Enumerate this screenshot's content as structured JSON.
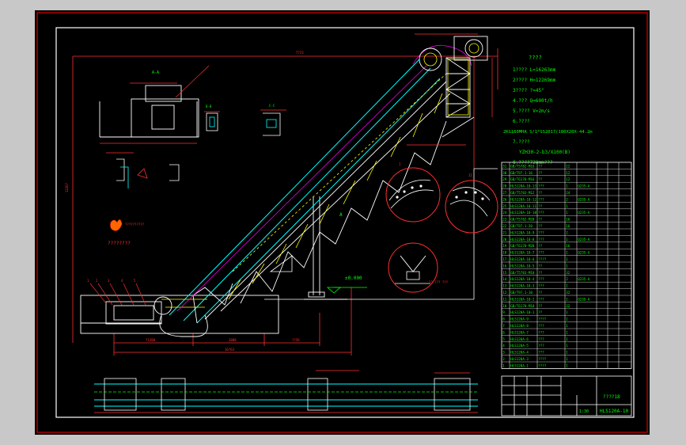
{
  "notes": {
    "title": "????",
    "lines": [
      "1???? L=16263mm",
      "2???? H=12269mm",
      "3???? ?=45°",
      "4.???  Q=600t/h",
      "5.???? V=2m/s",
      "6.????",
      "2KG160MHA S/1*SS2017(180X20X-44.2m",
      "7.????",
      "YZH30-2-b3/X100(B)",
      "8.????720mm???"
    ]
  },
  "labels": {
    "section_aa": "A-A",
    "elevation": "±0.000",
    "callout_a": "A",
    "logo_text": "????????"
  },
  "title_block": {
    "drawing_no": "HLS120A-10",
    "name": "????18",
    "scale": "1:30"
  },
  "bom": {
    "rows": [
      [
        "31",
        "GB/T5782-M16",
        "??",
        "12",
        "",
        "",
        "",
        ""
      ],
      [
        "30",
        "GB/T97.1-16",
        "??",
        "12",
        "",
        "",
        "",
        ""
      ],
      [
        "29",
        "GB/T6170-M16",
        "??",
        "12",
        "",
        "",
        "",
        ""
      ],
      [
        "28",
        "HLS120A-10-13",
        "???",
        "1",
        "Q235-A",
        "",
        "",
        ""
      ],
      [
        "27",
        "GB/T5783-M12",
        "??",
        "24",
        "",
        "",
        "",
        ""
      ],
      [
        "26",
        "HLS120A-10-12",
        "???",
        "2",
        "Q235-A",
        "",
        "",
        ""
      ],
      [
        "25",
        "HLS120A-10-11",
        "??",
        "1",
        "",
        "",
        "",
        ""
      ],
      [
        "24",
        "HLS120A-10-10",
        "???",
        "1",
        "Q235-A",
        "",
        "",
        ""
      ],
      [
        "23",
        "GB/T5782-M20",
        "??",
        "16",
        "",
        "",
        "",
        ""
      ],
      [
        "22",
        "GB/T97.1-20",
        "??",
        "16",
        "",
        "",
        "",
        ""
      ],
      [
        "21",
        "HLS120A-10-9",
        "???",
        "2",
        "",
        "",
        "",
        ""
      ],
      [
        "20",
        "HLS120A-10-8",
        "???",
        "1",
        "Q235-A",
        "",
        "",
        ""
      ],
      [
        "19",
        "GB/T6170-M20",
        "??",
        "16",
        "",
        "",
        "",
        ""
      ],
      [
        "18",
        "HLS120A-10-7",
        "???",
        "1",
        "Q235-A",
        "",
        "",
        ""
      ],
      [
        "17",
        "HLS120A-10-6",
        "????",
        "1",
        "",
        "",
        "",
        ""
      ],
      [
        "16",
        "HLS120A-10-5",
        "??",
        "1",
        "",
        "",
        "",
        ""
      ],
      [
        "15",
        "GB/T5783-M10",
        "??",
        "32",
        "",
        "",
        "",
        ""
      ],
      [
        "14",
        "HLS120A-10-4",
        "???",
        "2",
        "Q235-A",
        "",
        "",
        ""
      ],
      [
        "13",
        "HLS120A-10-3",
        "???",
        "1",
        "",
        "",
        "",
        ""
      ],
      [
        "12",
        "GB/T97.1-10",
        "??",
        "32",
        "",
        "",
        "",
        ""
      ],
      [
        "11",
        "HLS120A-10-2",
        "???",
        "1",
        "Q235-A",
        "",
        "",
        ""
      ],
      [
        "10",
        "GB/T6170-M10",
        "??",
        "32",
        "",
        "",
        "",
        ""
      ],
      [
        "9",
        "HLS120A-10-1",
        "??",
        "1",
        "",
        "",
        "",
        ""
      ],
      [
        "8",
        "HLS120A-9",
        "????",
        "1",
        "",
        "",
        "",
        ""
      ],
      [
        "7",
        "HLS120A-8",
        "???",
        "1",
        "",
        "",
        "",
        ""
      ],
      [
        "6",
        "HLS120A-7",
        "???",
        "1",
        "",
        "",
        "",
        ""
      ],
      [
        "5",
        "HLS120A-6",
        "???",
        "1",
        "",
        "",
        "",
        ""
      ],
      [
        "4",
        "HLS120A-5",
        "???",
        "1",
        "",
        "",
        "",
        ""
      ],
      [
        "3",
        "HLS120A-4",
        "???",
        "1",
        "",
        "",
        "",
        ""
      ],
      [
        "2",
        "HLS120A-3",
        "????",
        "1",
        "",
        "",
        "",
        ""
      ],
      [
        "1",
        "HLS120A-1",
        "????",
        "1",
        "",
        "",
        "",
        ""
      ]
    ]
  }
}
